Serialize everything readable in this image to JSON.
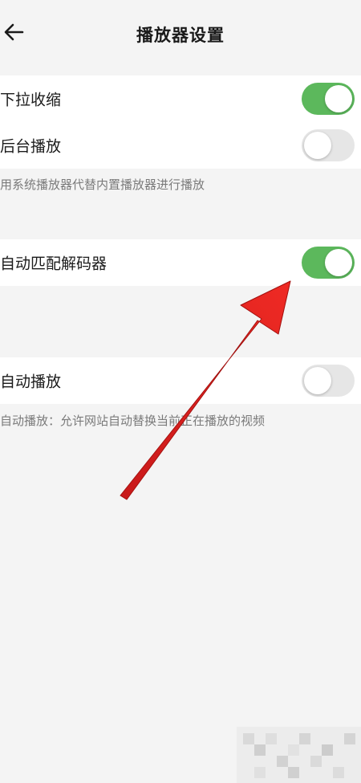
{
  "header": {
    "title": "播放器设置",
    "back_icon": "arrow-left-icon"
  },
  "group1": {
    "items": [
      {
        "label": "下拉收缩",
        "enabled": true
      },
      {
        "label": "后台播放",
        "enabled": false
      }
    ],
    "hint": "用系统播放器代替内置播放器进行播放"
  },
  "group2": {
    "items": [
      {
        "label": "自动匹配解码器",
        "enabled": true
      }
    ]
  },
  "group3": {
    "items": [
      {
        "label": "自动播放",
        "enabled": false
      }
    ],
    "hint": "自动播放：允许网站自动替换当前正在播放的视频"
  },
  "colors": {
    "toggle_on": "#5cb85c",
    "toggle_off": "#e6e6e6",
    "annotation_arrow": "#e0201e"
  }
}
